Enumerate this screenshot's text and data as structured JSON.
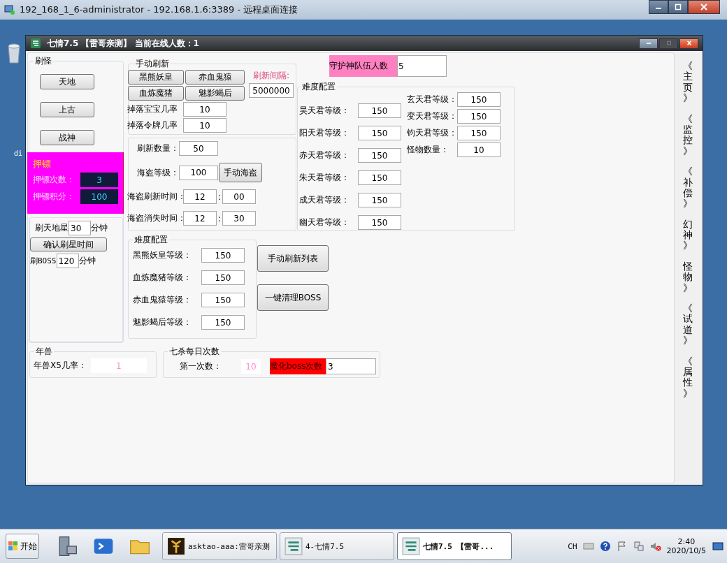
{
  "rdp_window": {
    "title": "192_168_1_6-administrator - 192.168.1.6:3389 - 远程桌面连接"
  },
  "desktop": {
    "icon_label": "di"
  },
  "app_window": {
    "title": "七情7.5 【雷哥亲测】 当前在线人数：1"
  },
  "brush_group": {
    "title": "刷怪",
    "buttons": [
      "天地",
      "上古",
      "战神"
    ]
  },
  "escort": {
    "title": "押镖",
    "fields": [
      {
        "label": "押镖次数：",
        "value": "3"
      },
      {
        "label": "押镖积分：",
        "value": "100"
      }
    ]
  },
  "star": {
    "label": "刷天地星",
    "value": "30",
    "unit": "分钟",
    "button": "确认刷星时间",
    "boss_label": "刷BOSS",
    "boss_value": "120",
    "boss_unit": "分钟"
  },
  "manual": {
    "title": "手动刷新",
    "buttons": [
      "黑熊妖皇",
      "赤血鬼猿",
      "血炼魔猪",
      "魅影蝎后"
    ],
    "interval_label": "刷新间隔:",
    "interval_value": "5000000",
    "rates": [
      {
        "label": "掉落宝宝几率",
        "value": "10"
      },
      {
        "label": "掉落令牌几率",
        "value": "10"
      }
    ]
  },
  "pirate": {
    "fields": [
      {
        "label": "刷新数量：",
        "value": "50"
      },
      {
        "label": "海盗等级：",
        "value": "100"
      }
    ],
    "button": "手动海盗",
    "times": [
      {
        "label": "海盗刷新时间：",
        "hour": "12",
        "separator": ":",
        "minute": "00"
      },
      {
        "label": "海盗消失时间：",
        "hour": "12",
        "separator": ":",
        "minute": "30"
      }
    ]
  },
  "boss_difficulty": {
    "title": "难度配置",
    "fields": [
      {
        "label": "黑熊妖皇等级：",
        "value": "150"
      },
      {
        "label": "血炼魔猪等级：",
        "value": "150"
      },
      {
        "label": "赤血鬼猿等级：",
        "value": "150"
      },
      {
        "label": "魅影蝎后等级：",
        "value": "150"
      }
    ]
  },
  "actions": [
    "手动刷新列表",
    "一键清理BOSS"
  ],
  "guard": {
    "label": "守护神队伍人数",
    "value": "5"
  },
  "tian_difficulty": {
    "title": "难度配置",
    "left": [
      {
        "label": "昊天君等级：",
        "value": "150"
      },
      {
        "label": "阳天君等级：",
        "value": "150"
      },
      {
        "label": "赤天君等级：",
        "value": "150"
      },
      {
        "label": "朱天君等级：",
        "value": "150"
      },
      {
        "label": "成天君等级：",
        "value": "150"
      },
      {
        "label": "幽天君等级：",
        "value": "150"
      }
    ],
    "right": [
      {
        "label": "玄天君等级：",
        "value": "150"
      },
      {
        "label": "变天君等级：",
        "value": "150"
      },
      {
        "label": "钧天君等级：",
        "value": "150"
      },
      {
        "label": "怪物数量：",
        "value": "10"
      }
    ]
  },
  "nian": {
    "title": "年兽",
    "label": "年兽X5几率：",
    "value": "1"
  },
  "qisha": {
    "title": "七杀每日次数",
    "label": "第一次数：",
    "value": "10",
    "boss_label": "魔化boss次数",
    "boss_value": "3"
  },
  "side_tabs": [
    "《主页》",
    "《监控》",
    "《补偿》",
    "幻神》",
    "怪物》",
    "《试道》",
    "《属性》"
  ],
  "taskbar": {
    "start": "开始",
    "tasks": [
      {
        "label": "asktao-aaa:雷哥亲测",
        "kind": "game",
        "selected": false
      },
      {
        "label": "4-七情7.5",
        "kind": "app",
        "selected": false
      },
      {
        "label": "七情7.5 【雷哥...",
        "kind": "app",
        "selected": true
      }
    ],
    "language": "CH",
    "time": "2:40",
    "date": "2020/10/5"
  }
}
